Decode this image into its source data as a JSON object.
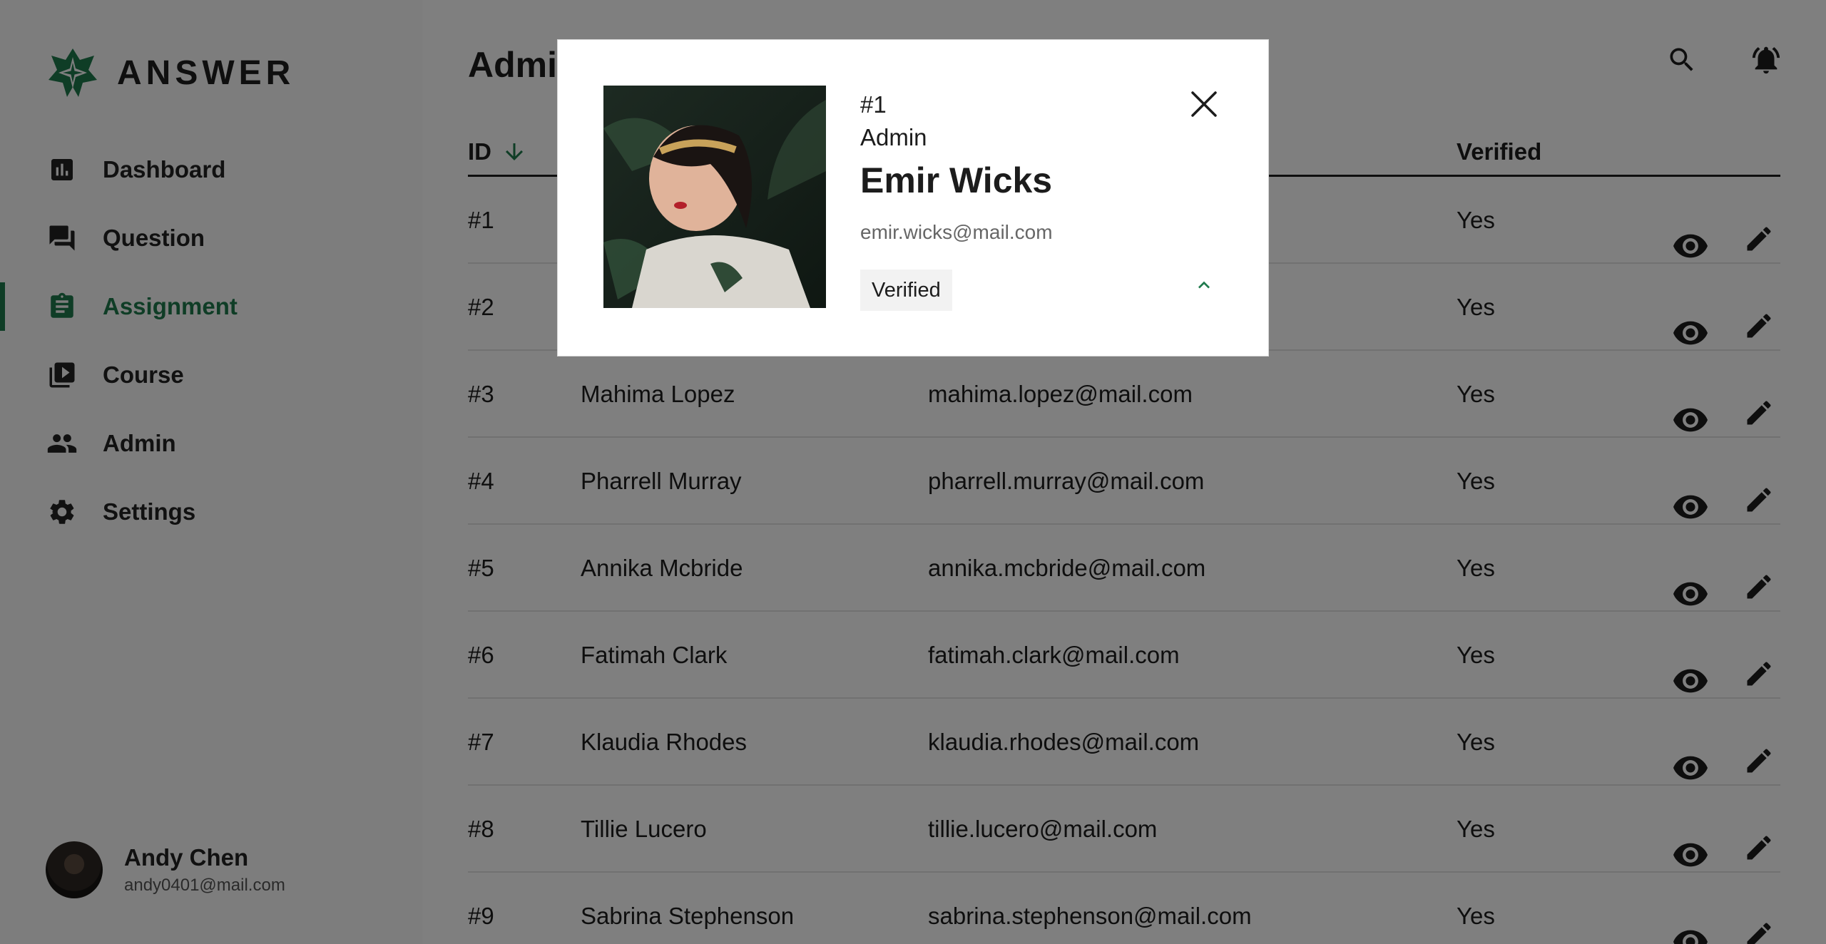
{
  "app": {
    "logo_text": "ANSWER"
  },
  "sidebar": {
    "items": [
      {
        "label": "Dashboard",
        "icon": "bar-chart-icon",
        "active": false
      },
      {
        "label": "Question",
        "icon": "chat-bubbles-icon",
        "active": false
      },
      {
        "label": "Assignment",
        "icon": "clipboard-icon",
        "active": true
      },
      {
        "label": "Course",
        "icon": "video-library-icon",
        "active": false
      },
      {
        "label": "Admin",
        "icon": "people-icon",
        "active": false
      },
      {
        "label": "Settings",
        "icon": "gear-icon",
        "active": false
      }
    ],
    "user": {
      "name": "Andy Chen",
      "email": "andy0401@mail.com"
    }
  },
  "header": {
    "title": "Admin"
  },
  "table": {
    "columns": {
      "id": "ID",
      "verified": "Verified"
    },
    "sort": {
      "column": "ID",
      "direction": "descending"
    },
    "rows": [
      {
        "id": "#1",
        "name": "",
        "email": "",
        "verified": "Yes"
      },
      {
        "id": "#2",
        "name": "",
        "email": "",
        "verified": "Yes"
      },
      {
        "id": "#3",
        "name": "Mahima Lopez",
        "email": "mahima.lopez@mail.com",
        "verified": "Yes"
      },
      {
        "id": "#4",
        "name": "Pharrell Murray",
        "email": "pharrell.murray@mail.com",
        "verified": "Yes"
      },
      {
        "id": "#5",
        "name": "Annika Mcbride",
        "email": "annika.mcbride@mail.com",
        "verified": "Yes"
      },
      {
        "id": "#6",
        "name": "Fatimah Clark",
        "email": "fatimah.clark@mail.com",
        "verified": "Yes"
      },
      {
        "id": "#7",
        "name": "Klaudia Rhodes",
        "email": "klaudia.rhodes@mail.com",
        "verified": "Yes"
      },
      {
        "id": "#8",
        "name": "Tillie Lucero",
        "email": "tillie.lucero@mail.com",
        "verified": "Yes"
      },
      {
        "id": "#9",
        "name": "Sabrina Stephenson",
        "email": "sabrina.stephenson@mail.com",
        "verified": "Yes"
      }
    ]
  },
  "modal": {
    "id": "#1",
    "role": "Admin",
    "name": "Emir Wicks",
    "email": "emir.wicks@mail.com",
    "badge": "Verified"
  },
  "colors": {
    "accent": "#1f7a4d",
    "text": "#1c1c1c",
    "overlay": "rgba(0,0,0,0.5)"
  }
}
